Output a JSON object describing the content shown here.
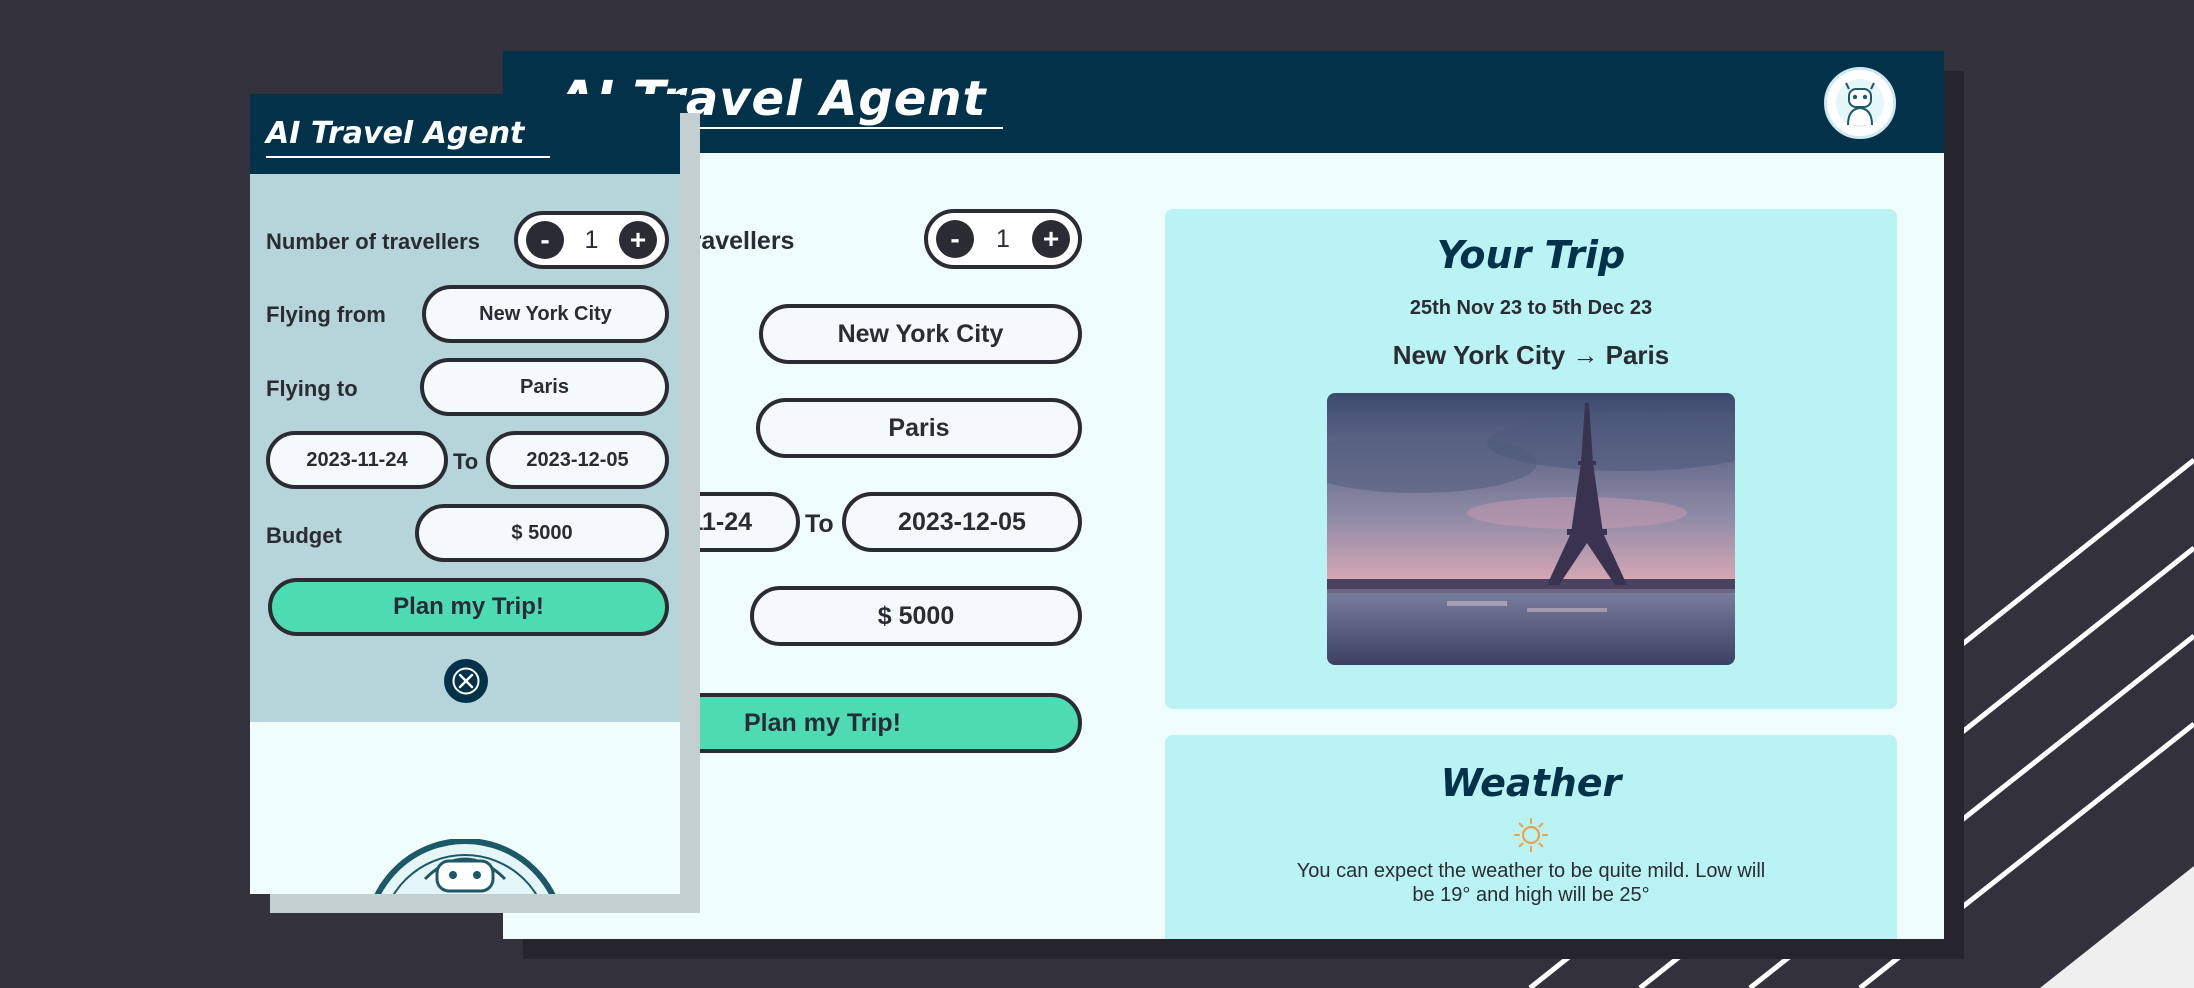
{
  "app": {
    "title": "AI Travel Agent"
  },
  "form": {
    "travellers_label": "Number of travellers",
    "travellers_label_partial": "f travellers",
    "travellers_count": "1",
    "minus_label": "-",
    "plus_label": "+",
    "from_label": "Flying from",
    "from_label_partial": "n",
    "from_value": "New York City",
    "to_label": "Flying to",
    "to_value": "Paris",
    "start_date": "2023-11-24",
    "start_date_partial": "11-24",
    "date_separator": "To",
    "end_date": "2023-12-05",
    "budget_label": "Budget",
    "budget_value": "$ 5000",
    "submit_label": "Plan my Trip!"
  },
  "trip": {
    "heading": "Your Trip",
    "dates": "25th Nov 23 to 5th Dec 23",
    "route": "New York City → Paris",
    "photo_icon": "eiffel-tower-photo"
  },
  "weather": {
    "heading": "Weather",
    "icon": "sun-icon",
    "description": "You can expect the weather to be quite mild. Low will be 19° and high will be 25°"
  },
  "colors": {
    "background": "#33313b",
    "header": "#02324a",
    "page": "#effdfc",
    "card": "#b9f3f3",
    "accent_button": "#4ddcb2",
    "mobile_form": "#b5d5da"
  }
}
